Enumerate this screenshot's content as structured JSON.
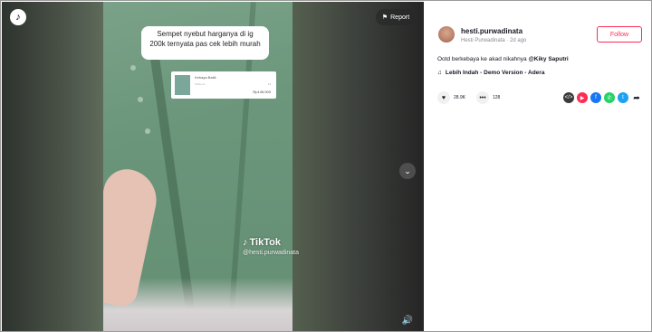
{
  "video": {
    "caption_line1": "Sempet nyebut harganya di ig",
    "caption_line2": "200k ternyata pas cek lebih murah",
    "product": {
      "name": "Kebaya Batik",
      "shop": "Tokko.id",
      "qty": "x1",
      "price": "Rp145.000"
    },
    "watermark_brand": "TikTok",
    "watermark_user": "@hesti.purwadinata",
    "report_label": "Report",
    "icons": {
      "logo": "tiktok-logo-icon",
      "report": "flag-icon",
      "next": "chevron-down-icon",
      "volume": "speaker-icon"
    }
  },
  "author": {
    "username": "hesti.purwadinata",
    "display_name": "Hesti Purwadinata",
    "posted": "2d ago",
    "follow_label": "Follow"
  },
  "post": {
    "description": "Ootd berkebaya ke akad nikahnya ",
    "mention": "@Kiky Saputri",
    "music": "Lebih Indah - Demo Version - Adera"
  },
  "stats": {
    "likes": "28.9K",
    "comments": "128"
  },
  "share_targets": [
    {
      "name": "embed",
      "color": "#3a3a3a",
      "glyph": "</>"
    },
    {
      "name": "send-to-friends",
      "color": "#fe2c55",
      "glyph": "▶"
    },
    {
      "name": "facebook",
      "color": "#1877f2",
      "glyph": "f"
    },
    {
      "name": "whatsapp",
      "color": "#25d366",
      "glyph": "✆"
    },
    {
      "name": "twitter",
      "color": "#1da1f2",
      "glyph": "t"
    },
    {
      "name": "more-share",
      "color": "#ffffff",
      "glyph": "➦"
    }
  ],
  "colors": {
    "accent": "#fe2c55",
    "text": "#161823",
    "muted": "#8a8b91"
  }
}
